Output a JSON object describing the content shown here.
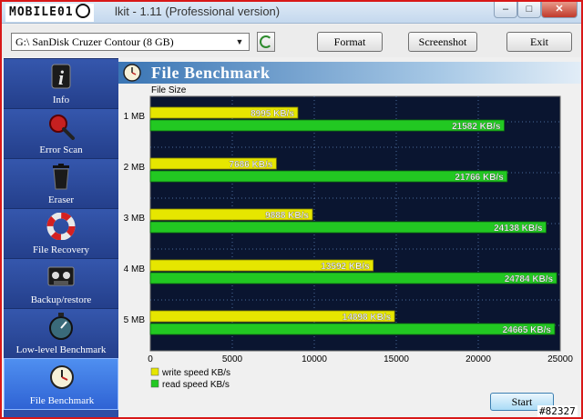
{
  "window": {
    "watermark": "MOBILE01",
    "title": "lkit - 1.11 (Professional version)",
    "stamp": "#82327"
  },
  "window_controls": {
    "minimize": "–",
    "maximize": "□",
    "close": "✕"
  },
  "toolbar": {
    "drive": "G:\\ SanDisk Cruzer Contour (8 GB)",
    "format_label": "Format",
    "screenshot_label": "Screenshot",
    "exit_label": "Exit"
  },
  "sidebar": {
    "items": [
      {
        "label": "Info",
        "icon": "info-icon"
      },
      {
        "label": "Error Scan",
        "icon": "magnifier-icon"
      },
      {
        "label": "Eraser",
        "icon": "trash-icon"
      },
      {
        "label": "File Recovery",
        "icon": "lifebuoy-icon"
      },
      {
        "label": "Backup/restore",
        "icon": "tape-icon"
      },
      {
        "label": "Low-level Benchmark",
        "icon": "stopwatch-icon"
      },
      {
        "label": "File Benchmark",
        "icon": "clock-icon"
      }
    ],
    "active": 6
  },
  "panel": {
    "title": "File Benchmark",
    "start_label": "Start"
  },
  "colors": {
    "write": "#e6e600",
    "read": "#22c822",
    "plot_bg": "#0a1530",
    "sidebar": "#2d4ea5"
  },
  "chart_data": {
    "type": "bar",
    "orientation": "horizontal",
    "ylabel": "File Size",
    "categories": [
      "1 MB",
      "2 MB",
      "3 MB",
      "4 MB",
      "5 MB"
    ],
    "series": [
      {
        "name": "write speed KB/s",
        "values": [
          8995,
          7686,
          9888,
          13592,
          14898
        ],
        "labels": [
          "8995 KB/s",
          "7686 KB/s",
          "9888 KB/s",
          "13592 KB/s",
          "14898 KB/s"
        ]
      },
      {
        "name": "read speed KB/s",
        "values": [
          21582,
          21766,
          24138,
          24784,
          24665
        ],
        "labels": [
          "21582 KB/s",
          "21766 KB/s",
          "24138 KB/s",
          "24784 KB/s",
          "24665 KB/s"
        ]
      }
    ],
    "xlim": [
      0,
      25000
    ],
    "xticks": [
      "0",
      "5000",
      "10000",
      "15000",
      "20000",
      "25000"
    ],
    "legend": "bottom-left",
    "grid": true
  }
}
